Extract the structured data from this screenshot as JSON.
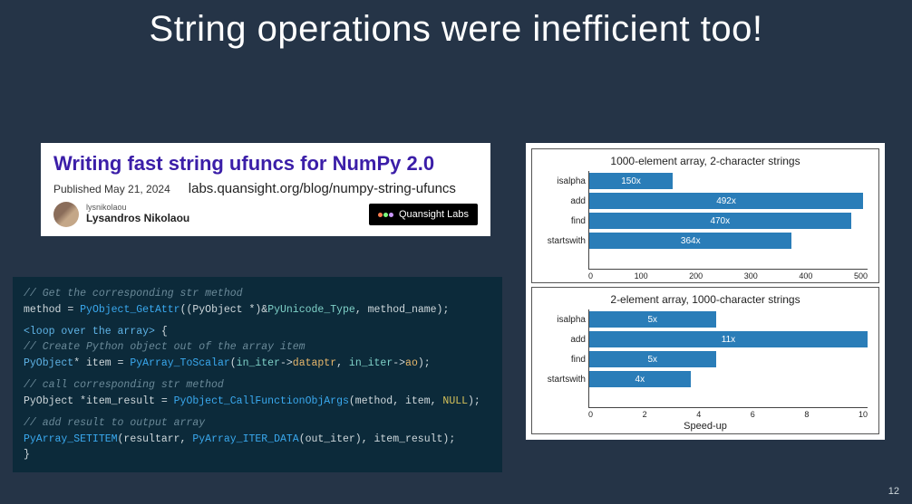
{
  "title": "String operations were inefficient too!",
  "card": {
    "headline": "Writing fast string ufuncs for NumPy 2.0",
    "published": "Published May 21, 2024",
    "link": "labs.quansight.org/blog/numpy-string-ufuncs",
    "handle": "lysnikolaou",
    "author": "Lysandros Nikolaou",
    "badge": "Quansight Labs"
  },
  "code": {
    "l1": "// Get the corresponding str method",
    "l2a": "method",
    "l2b": " = ",
    "l2c": "PyObject_GetAttr",
    "l2d": "((PyObject ",
    "l2e": "*",
    "l2f": ")&",
    "l2g": "PyUnicode_Type",
    "l2h": ", method_name);",
    "l3a": "<loop over the array>",
    "l3b": " {",
    "l4": "  // Create Python object out of the array item",
    "l5a": "  PyObject",
    "l5b": "*",
    "l5c": " item = ",
    "l5d": "PyArray_ToScalar",
    "l5e": "(",
    "l5f": "in_iter",
    "l5g": "->",
    "l5h": "dataptr",
    "l5i": ", ",
    "l5j": "in_iter",
    "l5k": "->",
    "l5l": "ao",
    "l5m": ");",
    "l6": "  // call corresponding str method",
    "l7a": "  PyObject ",
    "l7b": "*",
    "l7c": "item_result = ",
    "l7d": "PyObject_CallFunctionObjArgs",
    "l7e": "(method, item, ",
    "l7f": "NULL",
    "l7g": ");",
    "l8": "  // add result to output array",
    "l9a": "  PyArray_SETITEM",
    "l9b": "(resultarr, ",
    "l9c": "PyArray_ITER_DATA",
    "l9d": "(out_iter), item_result);",
    "l10": "}"
  },
  "chart_data": [
    {
      "type": "bar",
      "orientation": "horizontal",
      "title": "1000-element array, 2-character strings",
      "categories": [
        "isalpha",
        "add",
        "find",
        "startswith"
      ],
      "values": [
        150,
        492,
        470,
        364
      ],
      "value_labels": [
        "150x",
        "492x",
        "470x",
        "364x"
      ],
      "xlim": [
        0,
        500
      ],
      "xticks": [
        0,
        100,
        200,
        300,
        400,
        500
      ],
      "xlabel": "",
      "ylabel": ""
    },
    {
      "type": "bar",
      "orientation": "horizontal",
      "title": "2-element array, 1000-character strings",
      "categories": [
        "isalpha",
        "add",
        "find",
        "startswith"
      ],
      "values": [
        5,
        11,
        5,
        4
      ],
      "value_labels": [
        "5x",
        "11x",
        "5x",
        "4x"
      ],
      "xlim": [
        0,
        11
      ],
      "xticks": [
        0,
        2,
        4,
        6,
        8,
        10
      ],
      "xlabel": "Speed-up",
      "ylabel": ""
    }
  ],
  "page_number": "12"
}
